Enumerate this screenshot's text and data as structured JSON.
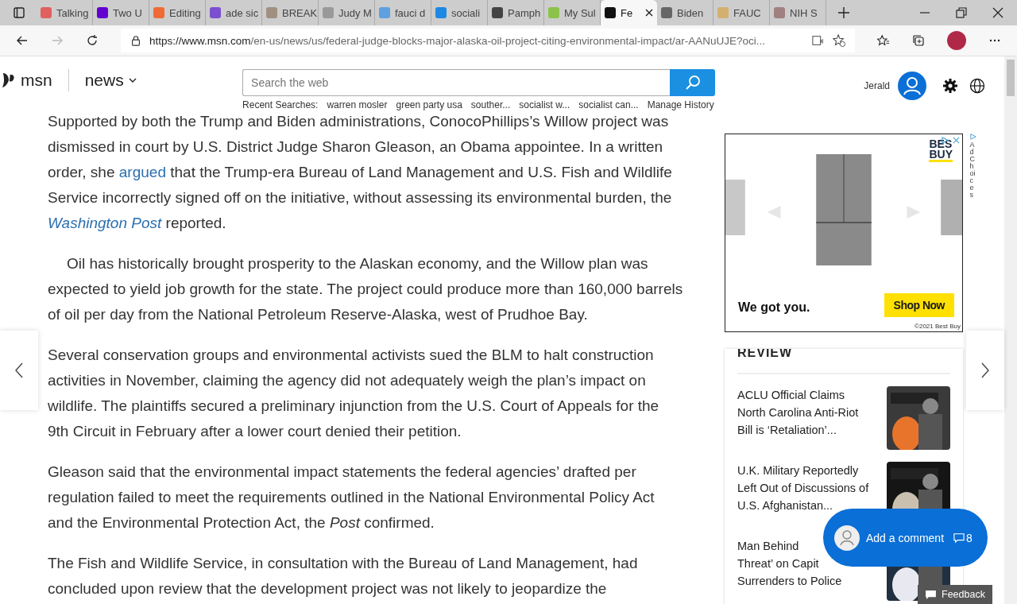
{
  "browser": {
    "tabs": [
      {
        "label": "Talking",
        "selected": false
      },
      {
        "label": "Two U",
        "selected": false
      },
      {
        "label": "Editing",
        "selected": false
      },
      {
        "label": "ade sic",
        "selected": false
      },
      {
        "label": "BREAK",
        "selected": false
      },
      {
        "label": "Judy M",
        "selected": false
      },
      {
        "label": "fauci d",
        "selected": false
      },
      {
        "label": "sociali",
        "selected": false
      },
      {
        "label": "Pamph",
        "selected": false
      },
      {
        "label": "My Sul",
        "selected": false
      },
      {
        "label": "Fe",
        "selected": true
      },
      {
        "label": "Biden",
        "selected": false
      },
      {
        "label": "FAUC",
        "selected": false
      },
      {
        "label": "NIH S",
        "selected": false
      }
    ],
    "url_host": "https://www.msn.com",
    "url_path": "/en-us/news/us/federal-judge-blocks-major-alaska-oil-project-citing-environmental-impact/ar-AANuUJE?oci..."
  },
  "header": {
    "logo": "msn",
    "section": "news",
    "search": {
      "placeholder": "Search the web"
    },
    "recent_label": "Recent Searches:",
    "recent": [
      "warren mosler",
      "green party usa",
      "souther...",
      "socialist w...",
      "socialist can...",
      "Manage History"
    ],
    "user": "Jerald"
  },
  "article": {
    "paragraphs": [
      {
        "indent": false,
        "parts": [
          {
            "kind": "text",
            "text": "Supported by both the Trump and Biden administrations, ConocoPhillips’s Willow project was dismissed in court by U.S. District Judge Sharon Gleason, an Obama appointee. In a written order, she "
          },
          {
            "kind": "link",
            "text": "argued"
          },
          {
            "kind": "text",
            "text": " that the Trump-era Bureau of Land Management and U.S. Fish and Wildlife Service incorrectly signed off on the initiative, without assessing its environmental burden, the "
          },
          {
            "kind": "link",
            "text": "*Washington Post*"
          },
          {
            "kind": "text",
            "text": " reported."
          }
        ]
      },
      {
        "indent": true,
        "parts": [
          {
            "kind": "text",
            "text": "Oil has historically brought prosperity to the Alaskan economy, and the Willow plan was expected to yield job growth for the state. The project could produce more than 160,000 barrels of oil per day from the National Petroleum Reserve-Alaska, west of Prudhoe Bay."
          }
        ]
      },
      {
        "indent": false,
        "parts": [
          {
            "kind": "text",
            "text": "Several conservation groups and environmental activists sued the BLM to halt construction activities in November, claiming the agency did not adequately weigh the plan’s impact on wildlife. The plaintiffs secured a preliminary injunction from the U.S. Court of Appeals for the 9th Circuit in February after a lower court denied their petition."
          }
        ]
      },
      {
        "indent": false,
        "parts": [
          {
            "kind": "text",
            "text": "Gleason said that the environmental impact statements the federal agencies’ drafted per regulation failed to meet the requirements outlined in the National Environmental Policy Act and the Environmental Protection Act, the *Post* confirmed."
          }
        ]
      },
      {
        "indent": false,
        "parts": [
          {
            "kind": "text",
            "text": "The Fish and Wildlife Service, in consultation with the Bureau of Land Management, had concluded upon review that the development project was not likely to jeopardize the"
          }
        ]
      }
    ]
  },
  "ad": {
    "logo_top": "BES",
    "logo_bottom": "BUY",
    "tagline": "We got you.",
    "button": "Shop Now",
    "copyright": "©2021 Best Buy",
    "adchoices": "AdChoices"
  },
  "sidebar": {
    "heading": "REVIEW",
    "items": [
      {
        "lines": [
          "ACLU Official Claims",
          "North Carolina Anti-Riot",
          "Bill is ‘Retaliation’..."
        ]
      },
      {
        "lines": [
          "U.K. Military Reportedly",
          "Left Out of Discussions of",
          "U.S. Afghanistan..."
        ]
      },
      {
        "lines": [
          "Man Behind",
          "Threat’ on Capit",
          "Surrenders to Police"
        ]
      }
    ]
  },
  "comment": {
    "label": "Add a comment",
    "count": "8"
  },
  "feedback": "Feedback"
}
